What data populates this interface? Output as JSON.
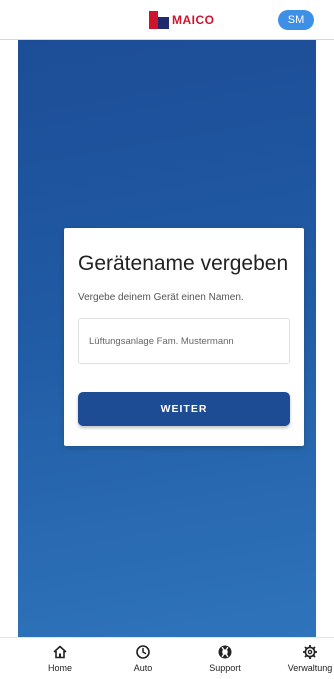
{
  "header": {
    "logo_text": "MAICO",
    "avatar_initials": "SM"
  },
  "dialog": {
    "title": "Gerätename vergeben",
    "subtitle": "Vergebe deinem Gerät einen Namen.",
    "name_input_value": "Lüftungsanlage Fam. Mustermann",
    "next_label": "WEITER"
  },
  "bottom_nav": {
    "items": [
      {
        "label": "Home",
        "icon": "home-icon"
      },
      {
        "label": "Auto",
        "icon": "clock-icon"
      },
      {
        "label": "Support",
        "icon": "lifebuoy-icon"
      },
      {
        "label": "Verwaltung",
        "icon": "gear-icon"
      }
    ]
  },
  "colors": {
    "brand_red": "#d0132b",
    "brand_navy": "#1d2a6b",
    "primary_blue": "#1d4b94",
    "avatar_blue": "#3e8fe6"
  }
}
